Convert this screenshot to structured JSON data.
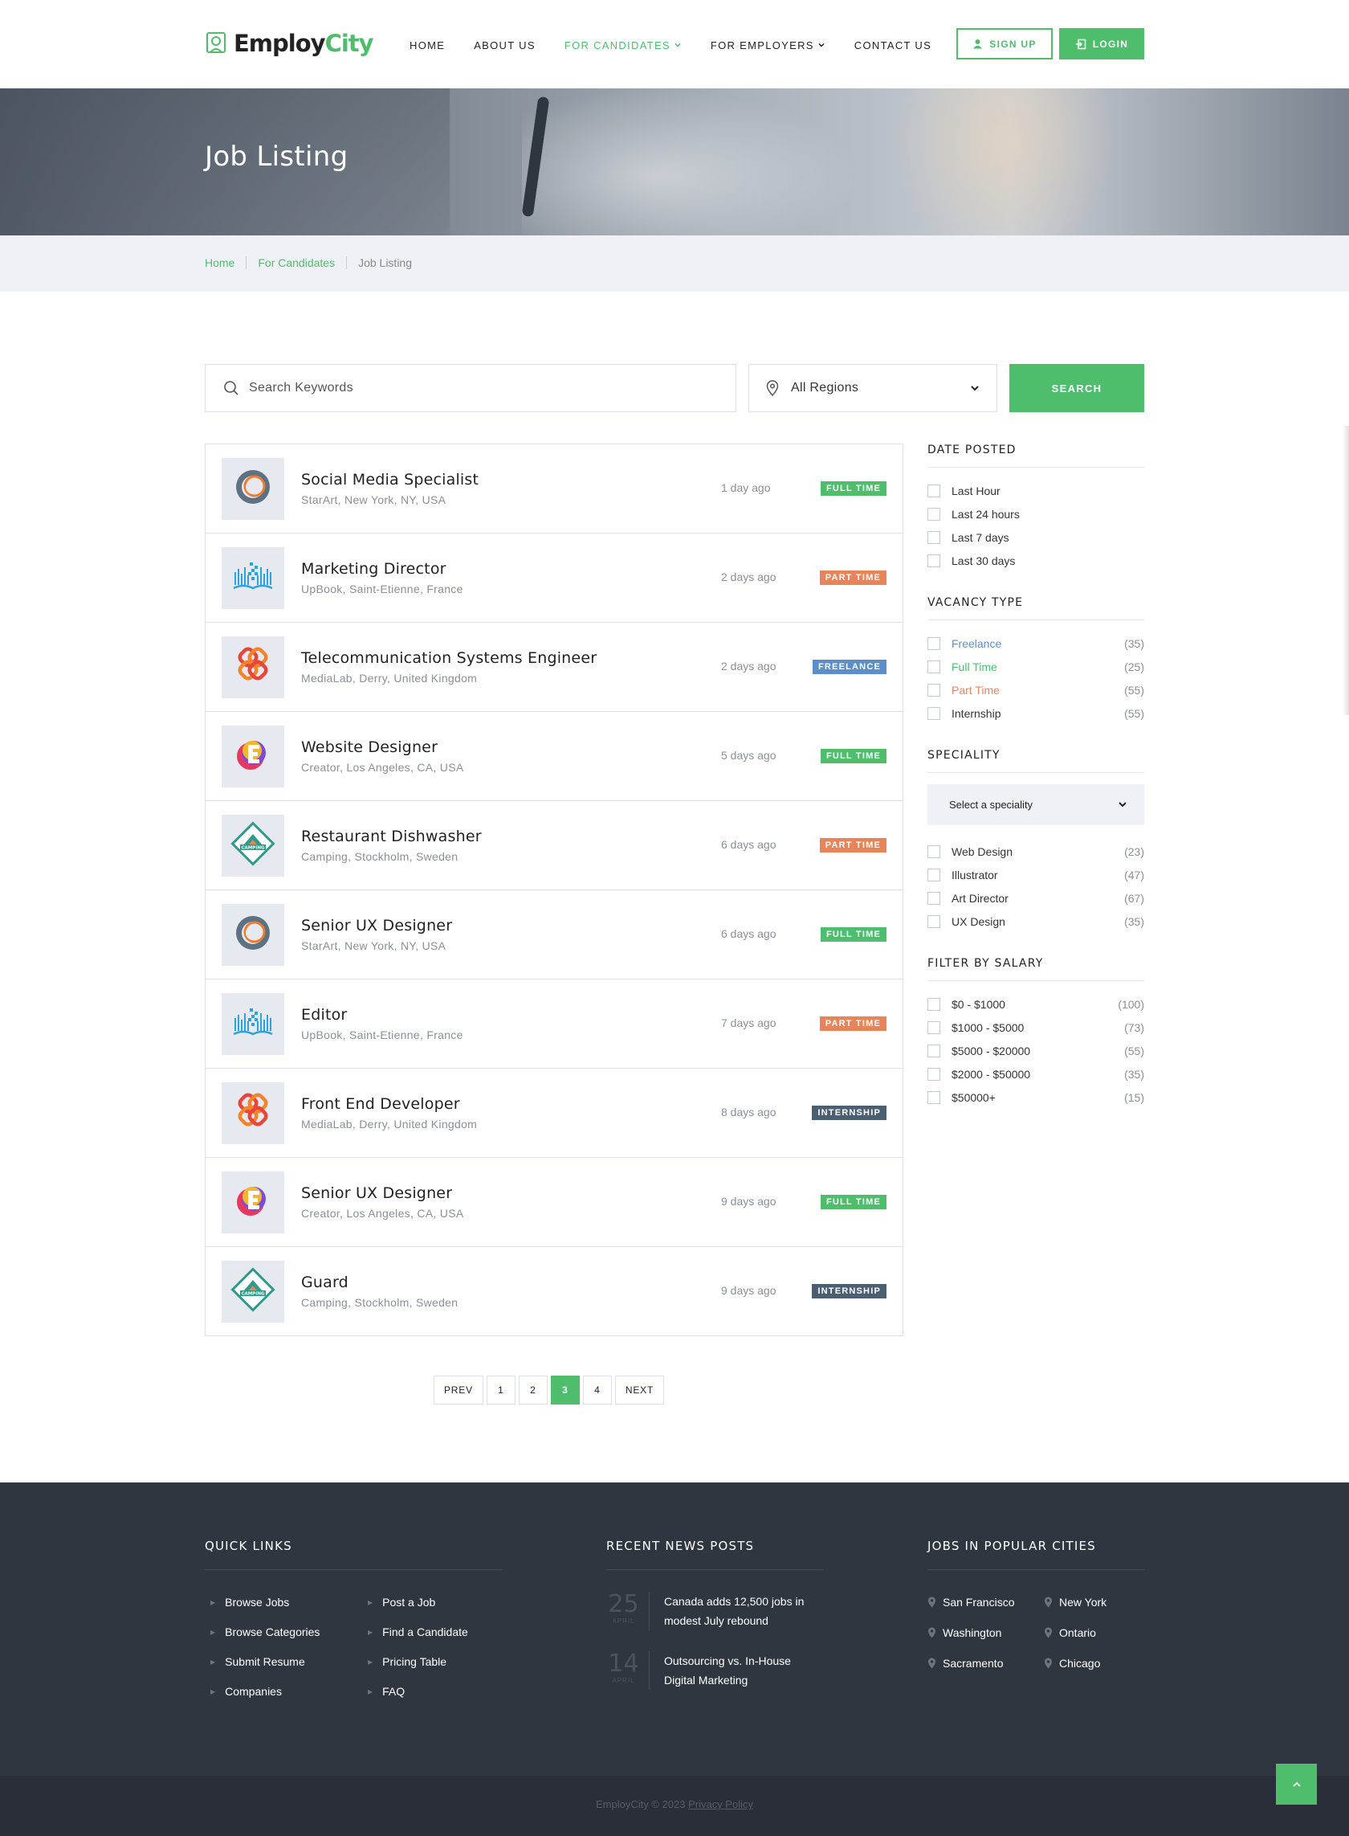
{
  "header": {
    "logo_part1": "Employ",
    "logo_part2": "City",
    "nav": [
      {
        "label": "HOME"
      },
      {
        "label": "ABOUT US"
      },
      {
        "label": "FOR CANDIDATES"
      },
      {
        "label": "FOR EMPLOYERS"
      },
      {
        "label": "CONTACT US"
      }
    ],
    "signup_label": "SIGN UP",
    "login_label": "LOGIN"
  },
  "hero": {
    "title": "Job Listing"
  },
  "breadcrumb": [
    "Home",
    "For Candidates",
    "Job Listing"
  ],
  "search": {
    "keywords_placeholder": "Search Keywords",
    "region_value": "All Regions",
    "button_label": "SEARCH"
  },
  "colors": {
    "accent": "#4ebd6c",
    "full_time": "#4ebd6c",
    "part_time": "#e8845a",
    "freelance": "#5a8fcb",
    "internship": "#4b5f73"
  },
  "jobs": [
    {
      "title": "Social Media Specialist",
      "location": "StarArt, New York, NY, USA",
      "posted": "1 day ago",
      "type": "FULL TIME",
      "logo": "starart-ring-icon"
    },
    {
      "title": "Marketing Director",
      "location": "UpBook, Saint-Etienne, France",
      "posted": "2 days ago",
      "type": "PART TIME",
      "logo": "upbook-book-icon"
    },
    {
      "title": "Telecommunication Systems Engineer",
      "location": "MediaLab, Derry, United Kingdom",
      "posted": "2 days ago",
      "type": "FREELANCE",
      "logo": "medialab-knot-icon"
    },
    {
      "title": "Website Designer",
      "location": "Creator, Los Angeles, CA, USA",
      "posted": "5 days ago",
      "type": "FULL TIME",
      "logo": "creator-e-icon"
    },
    {
      "title": "Restaurant Dishwasher",
      "location": "Camping, Stockholm, Sweden",
      "posted": "6 days ago",
      "type": "PART TIME",
      "logo": "camping-badge-icon"
    },
    {
      "title": "Senior UX Designer",
      "location": "StarArt, New York, NY, USA",
      "posted": "6 days ago",
      "type": "FULL TIME",
      "logo": "starart-ring-icon"
    },
    {
      "title": "Editor",
      "location": "UpBook, Saint-Etienne, France",
      "posted": "7 days ago",
      "type": "PART TIME",
      "logo": "upbook-book-icon"
    },
    {
      "title": "Front End Developer",
      "location": "MediaLab, Derry, United Kingdom",
      "posted": "8 days ago",
      "type": "INTERNSHIP",
      "logo": "medialab-knot-icon"
    },
    {
      "title": "Senior UX Designer",
      "location": "Creator, Los Angeles, CA, USA",
      "posted": "9 days ago",
      "type": "FULL TIME",
      "logo": "creator-e-icon"
    },
    {
      "title": "Guard",
      "location": "Camping, Stockholm, Sweden",
      "posted": "9 days ago",
      "type": "INTERNSHIP",
      "logo": "camping-badge-icon"
    }
  ],
  "sidebar": {
    "date_posted": {
      "title": "DATE POSTED",
      "options": [
        "Last Hour",
        "Last 24 hours",
        "Last 7 days",
        "Last 30 days"
      ]
    },
    "vacancy_type": {
      "title": "VACANCY TYPE",
      "options": [
        {
          "label": "Freelance",
          "count": "(35)"
        },
        {
          "label": "Full Time",
          "count": "(25)"
        },
        {
          "label": "Part Time",
          "count": "(55)"
        },
        {
          "label": "Internship",
          "count": "(55)"
        }
      ]
    },
    "speciality": {
      "title": "SPECIALITY",
      "select_placeholder": "Select a speciality",
      "options": [
        {
          "label": "Web Design",
          "count": "(23)"
        },
        {
          "label": "Illustrator",
          "count": "(47)"
        },
        {
          "label": "Art Director",
          "count": "(67)"
        },
        {
          "label": "UX Design",
          "count": "(35)"
        }
      ]
    },
    "salary": {
      "title": "FILTER BY SALARY",
      "options": [
        {
          "label": "$0 - $1000",
          "count": "(100)"
        },
        {
          "label": "$1000 - $5000",
          "count": "(73)"
        },
        {
          "label": "$5000 - $20000",
          "count": "(55)"
        },
        {
          "label": "$2000 - $50000",
          "count": "(35)"
        },
        {
          "label": "$50000+",
          "count": "(15)"
        }
      ]
    }
  },
  "pagination": {
    "prev": "PREV",
    "pages": [
      "1",
      "2",
      "3",
      "4"
    ],
    "current": "3",
    "next": "NEXT"
  },
  "footer": {
    "quick_links_title": "QUICK LINKS",
    "quick_links": [
      "Browse Jobs",
      "Post a Job",
      "Browse Categories",
      "Find a Candidate",
      "Submit Resume",
      "Pricing Table",
      "Companies",
      "FAQ"
    ],
    "news_title": "RECENT NEWS POSTS",
    "news": [
      {
        "day": "25",
        "month": "APRIL",
        "text": "Canada adds 12,500 jobs in modest July rebound"
      },
      {
        "day": "14",
        "month": "APRIL",
        "text": "Outsourcing vs. In-House Digital Marketing"
      }
    ],
    "cities_title": "JOBS IN POPULAR CITIES",
    "cities": [
      "San Francisco",
      "New York",
      "Washington",
      "Ontario",
      "Sacramento",
      "Chicago"
    ],
    "copyright": "EmployCity © 2023",
    "privacy": "Privacy Policy"
  }
}
